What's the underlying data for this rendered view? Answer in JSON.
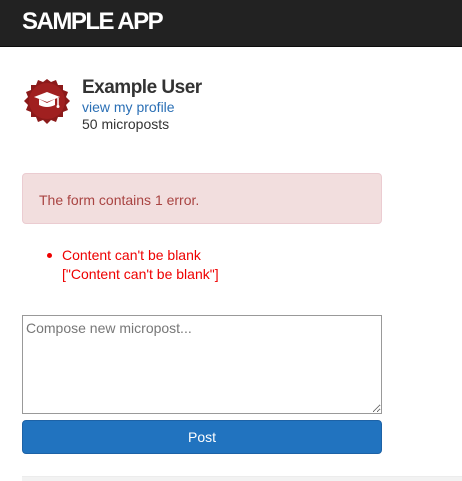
{
  "header": {
    "brand": "SAMPLE APP"
  },
  "user": {
    "name": "Example User",
    "profile_link": "view my profile",
    "microposts": "50 microposts"
  },
  "error": {
    "summary": "The form contains 1 error.",
    "messages": [
      {
        "line1": "Content can't be blank",
        "line2": "[\"Content can't be blank\"]"
      }
    ]
  },
  "compose": {
    "placeholder": "Compose new micropost...",
    "value": ""
  },
  "post_button": {
    "label": "Post"
  },
  "colors": {
    "navbar": "#222222",
    "error_text": "#ee0000",
    "alert_bg": "#f2dede",
    "alert_text": "#a94442",
    "link": "#2a6fb5",
    "button": "#2173bf"
  }
}
